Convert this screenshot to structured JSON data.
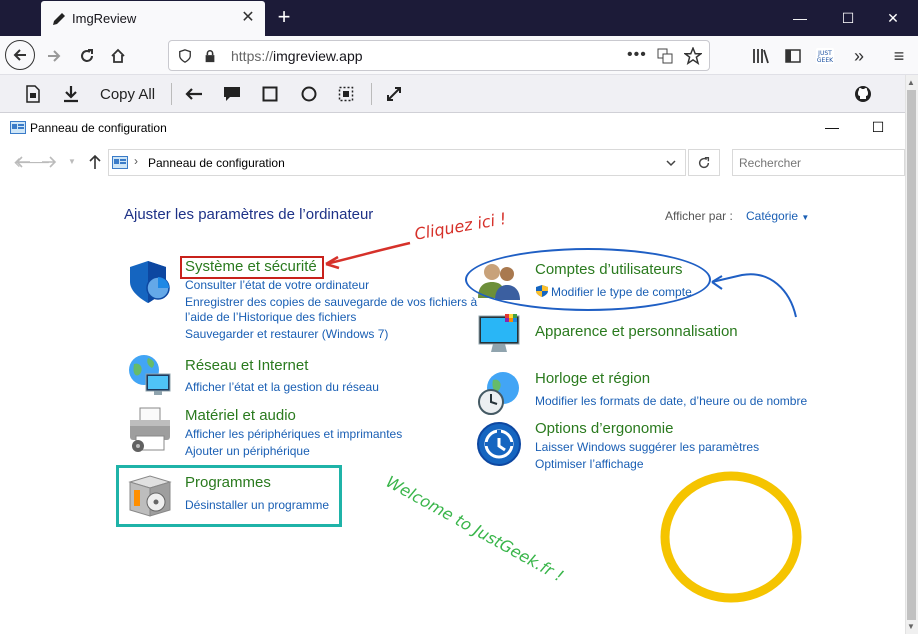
{
  "browser": {
    "tab_title": "ImgReview",
    "url_protocol": "https://",
    "url_host": "imgreview.app",
    "copy_all_label": "Copy All"
  },
  "window": {
    "title": "Panneau de configuration",
    "breadcrumb": "Panneau de configuration",
    "search_placeholder": "Rechercher"
  },
  "panel": {
    "heading": "Ajuster les paramètres de l’ordinateur",
    "view_by_label": "Afficher par :",
    "view_by_value": "Catégorie",
    "categories_left": [
      {
        "title": "Système et sécurité",
        "links": [
          "Consulter l’état de votre ordinateur",
          "Enregistrer des copies de sauvegarde de vos fichiers à",
          "l’aide de l’Historique des fichiers",
          "Sauvegarder et restaurer (Windows 7)"
        ]
      },
      {
        "title": "Réseau et Internet",
        "links": [
          "Afficher l’état et la gestion du réseau"
        ]
      },
      {
        "title": "Matériel et audio",
        "links": [
          "Afficher les périphériques et imprimantes",
          "Ajouter un périphérique"
        ]
      },
      {
        "title": "Programmes",
        "links": [
          "Désinstaller un programme"
        ]
      }
    ],
    "categories_right": [
      {
        "title": "Comptes d’utilisateurs",
        "links": [
          "Modifier le type de compte"
        ]
      },
      {
        "title": "Apparence et personnalisation",
        "links": []
      },
      {
        "title": "Horloge et région",
        "links": [
          "Modifier les formats de date, d’heure ou de nombre"
        ]
      },
      {
        "title": "Options d’ergonomie",
        "links": [
          "Laisser Windows suggérer les paramètres",
          "Optimiser l’affichage"
        ]
      }
    ]
  },
  "annotations": {
    "click_here": "Cliquez ici !",
    "welcome": "Welcome to JustGeek.fr !",
    "colors": {
      "red": "#d6312a",
      "blue": "#1f5fc4",
      "teal": "#1fb3a8",
      "yellow": "#f5c400",
      "green": "#39b54a"
    }
  }
}
